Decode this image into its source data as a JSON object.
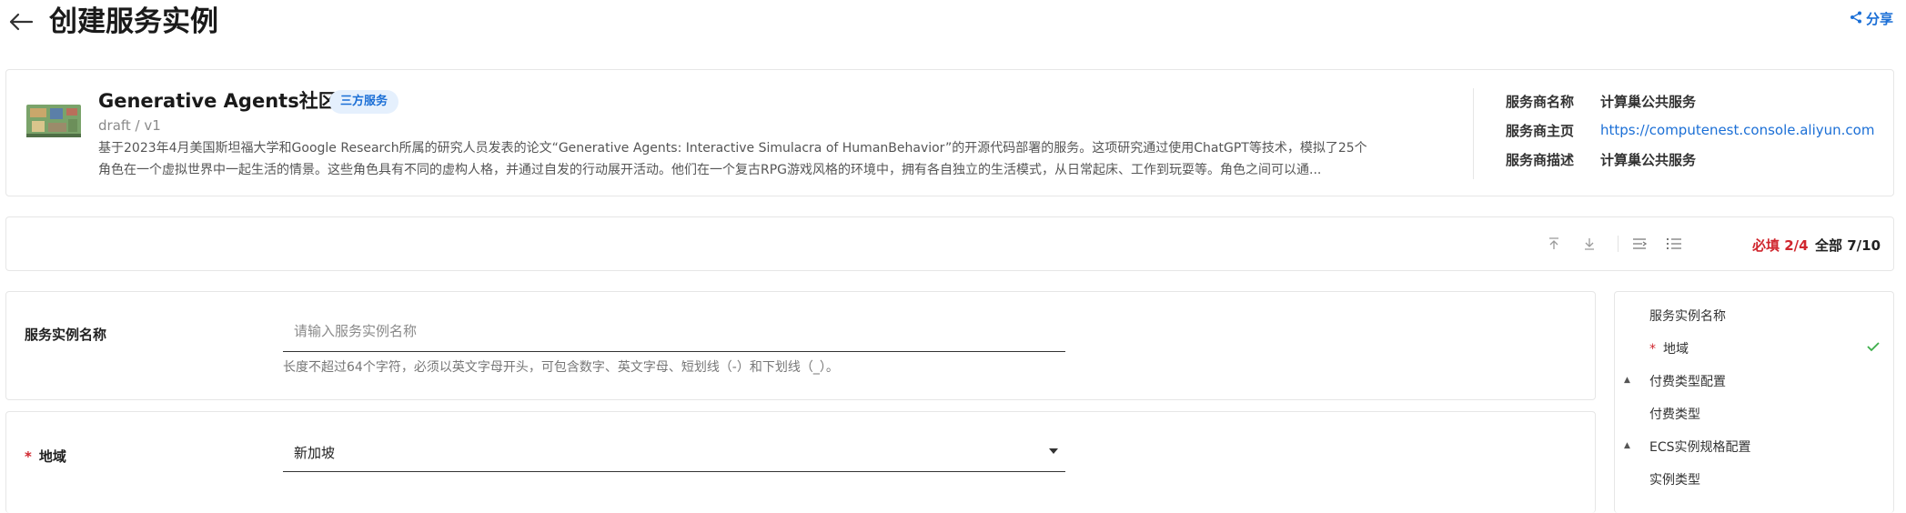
{
  "header": {
    "title": "创建服务实例",
    "share_label": "分享"
  },
  "service": {
    "name": "Generative Agents社区版",
    "badge": "三方服务",
    "version": "draft / v1",
    "description_line1": "基于2023年4月美国斯坦福大学和Google Research所属的研究人员发表的论文“Generative Agents: Interactive Simulacra of HumanBehavior”的开源代码部署的服务。这项研究通过使用ChatGPT等技术，模拟了25个",
    "description_line2": "角色在一个虚拟世界中一起生活的情景。这些角色具有不同的虚构人格，并通过自发的行动展开活动。他们在一个复古RPG游戏风格的环境中，拥有各自独立的生活模式，从日常起床、工作到玩耍等。角色之间可以通..."
  },
  "provider": {
    "name_key": "服务商名称",
    "name_val": "计算巢公共服务",
    "home_key": "服务商主页",
    "home_val": "https://computenest.console.aliyun.com",
    "desc_key": "服务商描述",
    "desc_val": "计算巢公共服务"
  },
  "toolbar": {
    "required_label": "必填 2/4",
    "all_label": "全部 7/10"
  },
  "form": {
    "instance_name": {
      "label": "服务实例名称",
      "placeholder": "请输入服务实例名称",
      "hint": "长度不超过64个字符，必须以英文字母开头，可包含数字、英文字母、短划线（-）和下划线（_）。"
    },
    "region": {
      "required_mark": "*",
      "label": "地域",
      "value": "新加坡"
    }
  },
  "nav": {
    "items": [
      {
        "label": "服务实例名称"
      },
      {
        "label": "地域",
        "required_mark": "*"
      },
      {
        "label": "付费类型配置",
        "arrow": "▲"
      },
      {
        "label": "付费类型"
      },
      {
        "label": "ECS实例规格配置",
        "arrow": "▲"
      },
      {
        "label": "实例类型"
      }
    ]
  },
  "colors": {
    "accent": "#1b6fd6",
    "required": "#d0262e",
    "check": "#3cae4a"
  }
}
